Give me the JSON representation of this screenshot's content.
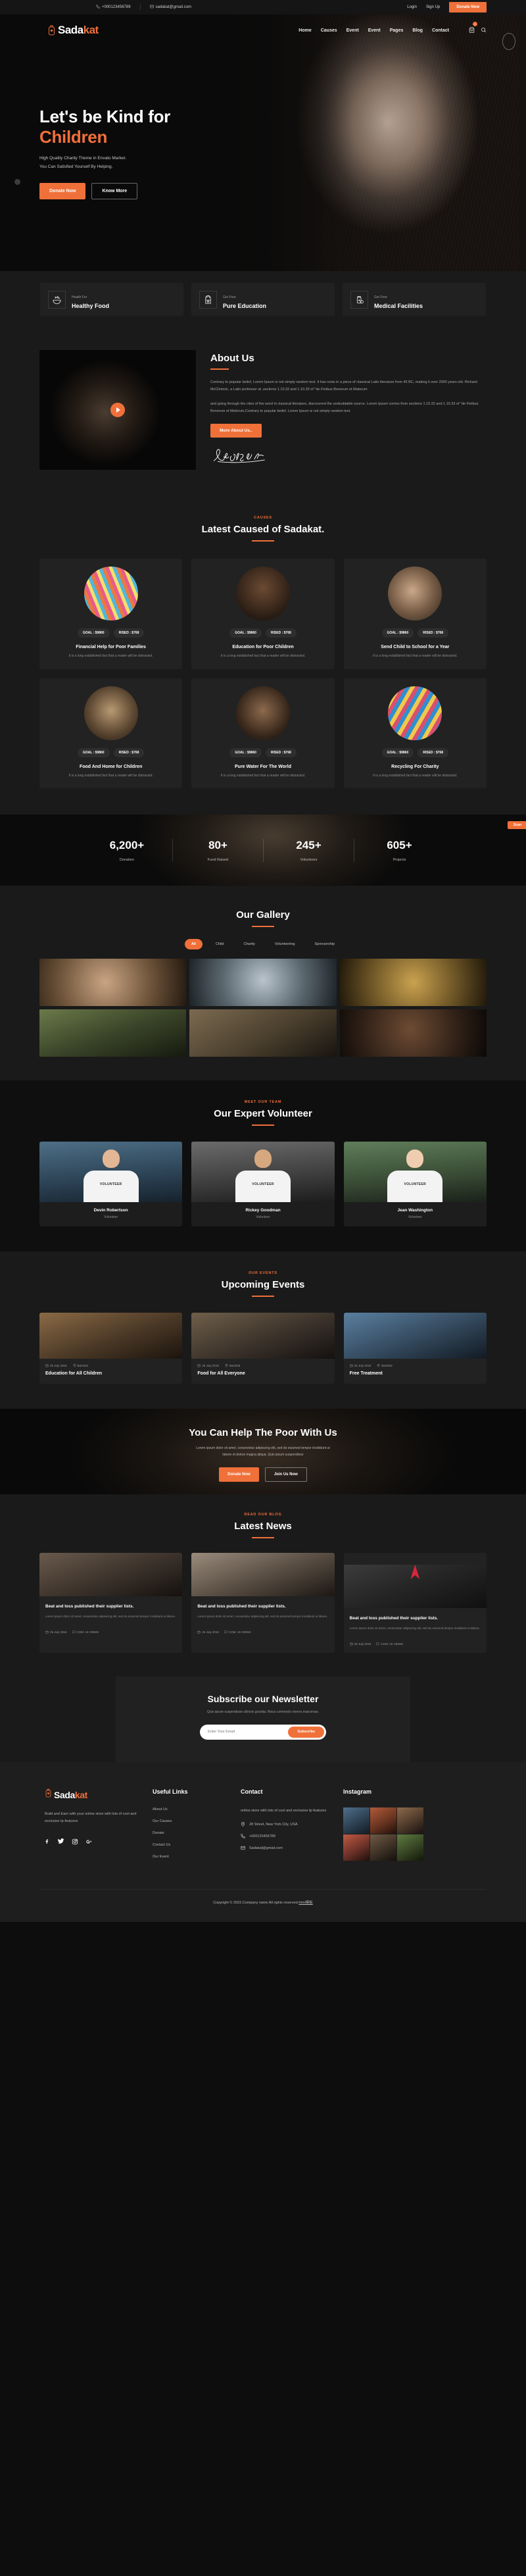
{
  "topbar": {
    "phone": "+000123456789",
    "email": "sadakat@gmail.com",
    "login": "Login",
    "signup": "Sign Up",
    "donate": "Donate Now",
    "phone_icon": "phone-icon",
    "mail_icon": "envelope-icon"
  },
  "brand": {
    "part1": "Sada",
    "part2": "kat",
    "mark_icon": "charity-jar-heart-icon"
  },
  "nav": {
    "items": [
      "Home",
      "Causes",
      "Event",
      "Event",
      "Pages",
      "Blog",
      "Contact"
    ],
    "cart_icon": "cart-icon",
    "cart_count": "0",
    "search_icon": "search-icon"
  },
  "hero": {
    "title_line1": "Let's be Kind for",
    "title_line2": "Children",
    "sub_line1": "High Quality Charity Theme in Envato Market.",
    "sub_line2": "You Can Satisfied Yourself By Helping.",
    "btn_primary": "Donate Now",
    "btn_outline": "Know More"
  },
  "features": [
    {
      "small": "Health For",
      "big": "Healthy Food",
      "icon": "food-bowl-icon"
    },
    {
      "small": "Get Free",
      "big": "Pure Education",
      "icon": "school-bag-icon"
    },
    {
      "small": "Get Free",
      "big": "Medical Facilities",
      "icon": "medicine-bottle-icon"
    }
  ],
  "about": {
    "title": "About Us",
    "p1": "Contrary to popular belief, Lorem Ipsum is not simply random text. It has roots in a piece of classical Latin literature from 45 BC, making it over 2000 years old. Richard McClintock, a Latin professor at ,sections 1.10.32 and 1.10.33 of \"de Finibus Bonorum et Malorum",
    "p2": "and going through the cites of the word in classical literature, discovered the undoubtable source. Lorem Ipsum comes from sections 1.10.32 and 1.10.33 of \"de Finibus Bonorum et Malorum,Contrary to popular belief, Lorem Ipsum is not simply random text.",
    "button": "More About Us..",
    "play_icon": "play-button-icon",
    "signature_alt": "Joan Sinatra signature"
  },
  "causes": {
    "eyebrow": "CAUSES",
    "title": "Latest Caused of Sadakat.",
    "goal_label": "GOAL : $9860",
    "rised_label": "RISED : $768",
    "desc": "It is a long established fact that a reader will be distracted.",
    "items": [
      {
        "name": "Financial Help for Poor Families",
        "photo": "cp1"
      },
      {
        "name": "Education for Poor Children",
        "photo": "cp2"
      },
      {
        "name": "Send Child to School for a Year",
        "photo": "cp3"
      },
      {
        "name": "Food And Home for Children",
        "photo": "cp4"
      },
      {
        "name": "Pure Water For The World",
        "photo": "cp5"
      },
      {
        "name": "Recycling For Charity",
        "photo": "cp6"
      }
    ]
  },
  "counter": {
    "tag": "Scan",
    "items": [
      {
        "num": "6,200+",
        "label": "Donation"
      },
      {
        "num": "80+",
        "label": "Fund Raised"
      },
      {
        "num": "245+",
        "label": "Volunteers"
      },
      {
        "num": "605+",
        "label": "Projects"
      }
    ]
  },
  "gallery": {
    "title": "Our Gallery",
    "tabs": [
      "All",
      "Child",
      "Charity",
      "Volunteering",
      "Sponsorship"
    ],
    "active_tab": "All",
    "cells": [
      "g1",
      "g2",
      "g3",
      "g4",
      "g5",
      "g6"
    ]
  },
  "volunteer": {
    "eyebrow": "Meet Our Team",
    "title": "Our Expert Volunteer",
    "shirt_text": "VOLUNTEER",
    "members": [
      {
        "name": "Devin Robertson",
        "role": "Volunteer"
      },
      {
        "name": "Rickey Goodman",
        "role": "Volunteer"
      },
      {
        "name": "Jean Washington",
        "role": "Volunteer"
      }
    ]
  },
  "events": {
    "eyebrow": "Our Events",
    "title": "Upcoming Events",
    "date": "25 July 2018",
    "location": "Barishal",
    "items": [
      {
        "name": "Education for All Children"
      },
      {
        "name": "Food for All Everyone"
      },
      {
        "name": "Free Treatment"
      }
    ]
  },
  "cta": {
    "title": "You Can Help The Poor With Us",
    "sub_line1": "Lorem ipsum dolor sit amet, consectetur adipiscing elit, sed do eiusmod tempor incididunt ut",
    "sub_line2": "labore et dolore magna aliqua. Quis ipsum suspendisse",
    "btn_primary": "Donate Now",
    "btn_outline": "Join Us Now"
  },
  "news": {
    "eyebrow": "Read Our Blog",
    "title": "Latest News",
    "date": "25 July 2018",
    "comments": "COM: 15 VIEWS",
    "items": [
      {
        "title": "Beat and loss published their supplier lists.",
        "desc": "Lorem ipsum dolor sit amet, consectetur adipiscing elit, sed do eiusmod tempor incididunt ut labore."
      },
      {
        "title": "Beat and loss published their supplier lists.",
        "desc": "Lorem ipsum dolor sit amet, consectetur adipiscing elit, sed do eiusmod tempor incididunt ut labore."
      },
      {
        "title": "Beat and loss published their supplier lists.",
        "desc": "Lorem ipsum dolor sit amet, consectetur adipiscing elit, sed do eiusmod tempor incididunt ut labore."
      }
    ]
  },
  "newsletter": {
    "title": "Subscribe our Newsletter",
    "sub": "Quis ipsum suspendisse ultrices gravida. Risus commodo viverra maecenas.",
    "placeholder": "Enter Your Email",
    "button": "Subscribe"
  },
  "footer": {
    "desc": "Build and Earn with your online store with lots of cool and exclusive tp-features",
    "social": [
      "facebook-icon",
      "twitter-icon",
      "instagram-icon",
      "google-plus-icon"
    ],
    "links_head": "Useful Links",
    "links": [
      "About Us",
      "Our Causes",
      "Donate",
      "Contact Us",
      "Our Event"
    ],
    "contact_head": "Contact",
    "contact_desc": "online store with lots of cool and exclusive tp-features",
    "address": "28 Street, New York City, USA",
    "phone": "+000123456789",
    "email": "Sadakat@gmail.com",
    "instagram_head": "Instagram",
    "instagram_cells": [
      "i1",
      "i2",
      "i3",
      "i4",
      "i5",
      "i6"
    ],
    "copyright_pre": "Copyright © 2022.Company name All rights reserved.",
    "copyright_link": "html模板"
  },
  "colors": {
    "accent": "#f0703a",
    "bg_dark": "#0d0d0d",
    "bg_panel": "#1a1a1a",
    "card": "#222222"
  }
}
